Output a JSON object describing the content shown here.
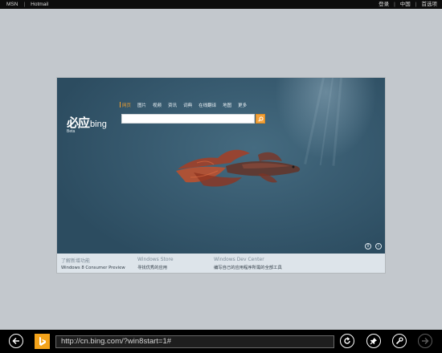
{
  "topbar": {
    "left_links": [
      "MSN",
      "Hotmail"
    ],
    "right_links": [
      "登录",
      "中国",
      "首选项"
    ]
  },
  "preview": {
    "logo_cn": "必应",
    "logo_en": "bing",
    "logo_beta": "Beta",
    "nav": [
      "网页",
      "图片",
      "视频",
      "资讯",
      "词典",
      "在线翻译",
      "地图",
      "更多"
    ],
    "search_value": "",
    "footer": [
      {
        "heading": "了解新增功能",
        "subtitle": "Windows 8 Consumer Preview"
      },
      {
        "heading": "Windows Store",
        "subtitle": "寻找优秀的应用"
      },
      {
        "heading": "Windows Dev Center",
        "subtitle": "编写自己的应用程序所需的全部工具"
      }
    ]
  },
  "appbar": {
    "url": "http://cn.bing.com/?win8start=1#"
  },
  "icons": {
    "back": "back-arrow-icon",
    "site": "bing-favicon-icon",
    "refresh": "refresh-icon",
    "pin": "pin-icon",
    "tools": "wrench-icon",
    "forward": "forward-arrow-icon"
  },
  "colors": {
    "accent": "#f4a31a",
    "nav_active": "#f0a030"
  }
}
